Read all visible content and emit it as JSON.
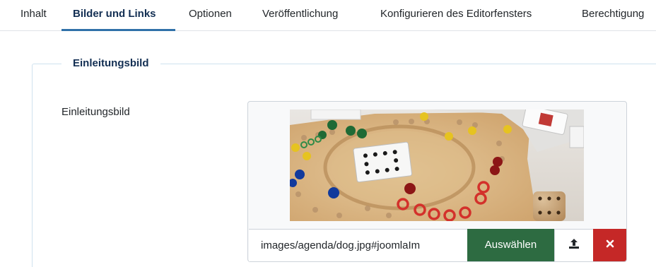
{
  "tabs": [
    {
      "label": "Inhalt"
    },
    {
      "label": "Bilder und Links"
    },
    {
      "label": "Optionen"
    },
    {
      "label": "Veröffentlichung"
    },
    {
      "label": "Konfigurieren des Editorfensters"
    },
    {
      "label": "Berechtigung"
    }
  ],
  "active_tab": "Bilder und Links",
  "fieldset": {
    "legend": "Einleitungsbild",
    "field_label": "Einleitungsbild",
    "path_value": "images/agenda/dog.jpg#joomlaIm",
    "select_label": "Auswählen",
    "upload_icon": "upload-icon",
    "clear_icon": "close-icon"
  },
  "colors": {
    "tab_active_underline": "#3071a9",
    "select_button": "#2d6b41",
    "clear_button": "#c52827",
    "fieldset_border": "#cfe2ef"
  }
}
